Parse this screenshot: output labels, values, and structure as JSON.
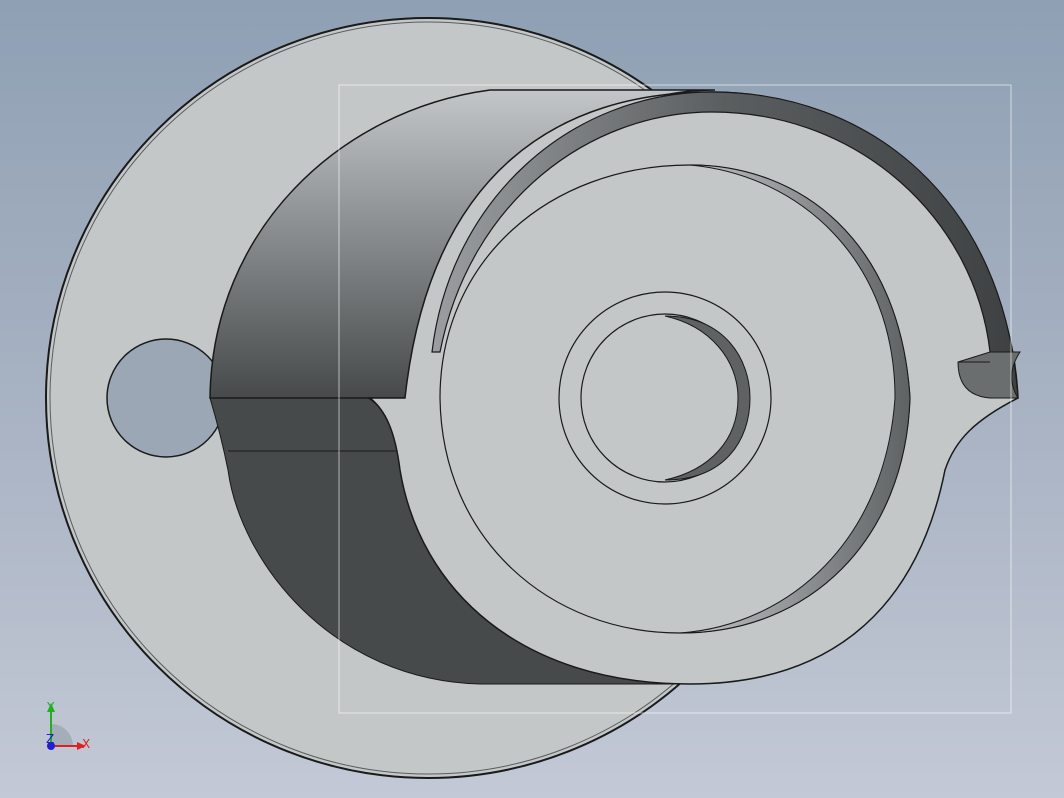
{
  "viewport": {
    "background_top": "#8fa0b4",
    "background_bottom": "#c3c9d6"
  },
  "model": {
    "face_color": "#c4c7c8",
    "shadow_color": "#474a4a",
    "edge_color": "#1a1a1a",
    "highlight_color": "#ffffff"
  },
  "triad": {
    "x_label": "X",
    "y_label": "Y",
    "z_label": "Z",
    "x_color": "#e02020",
    "y_color": "#20b020",
    "z_color": "#2020d0"
  }
}
